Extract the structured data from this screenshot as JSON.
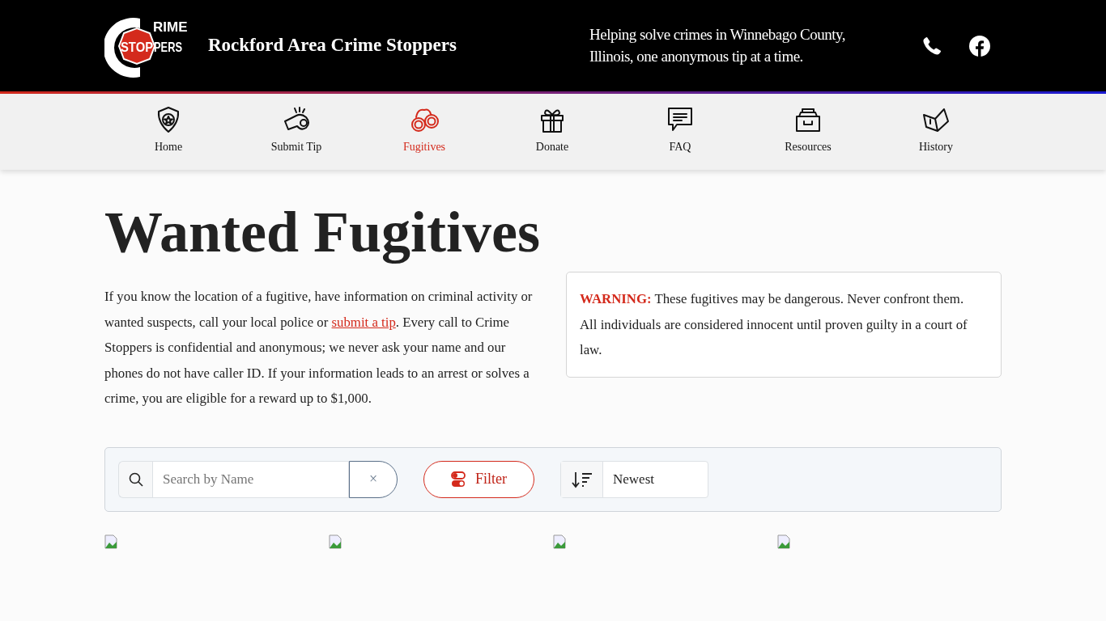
{
  "header": {
    "logo": {
      "top": "RIME",
      "stop": "STOP",
      "rest": "PERS"
    },
    "site_title": "Rockford Area Crime Stoppers",
    "tagline": "Helping solve crimes in Winnebago County, Illinois, one anonymous tip at a time.",
    "icons": [
      {
        "kind": "phone"
      },
      {
        "kind": "facebook"
      }
    ]
  },
  "nav": [
    {
      "label": "Home",
      "selected": false
    },
    {
      "label": "Submit Tip",
      "selected": false
    },
    {
      "label": "Fugitives",
      "selected": true
    },
    {
      "label": "Donate",
      "selected": false
    },
    {
      "label": "FAQ",
      "selected": false
    },
    {
      "label": "Resources",
      "selected": false
    },
    {
      "label": "History",
      "selected": false
    }
  ],
  "page_title": "Wanted Fugitives",
  "intro": {
    "before": "If you know the location of a fugitive, have information on criminal activity or wanted suspects, call your local police or",
    "link": "submit a tip",
    "after": ". Every call to Crime Stoppers is confidential and anonymous; we never ask your name and our phones do not have caller ID. If your information leads to an arrest or solves a crime, you are eligible for a reward up to $1,000."
  },
  "warning": {
    "label": "WARNING:",
    "text": "These fugitives may be dangerous. Never confront them. All individuals are considered innocent until proven guilty in a court of law."
  },
  "toolbar": {
    "search": {
      "placeholder": "Search by Name",
      "clear": "×"
    },
    "filter": "Filter",
    "sort": "Newest"
  }
}
